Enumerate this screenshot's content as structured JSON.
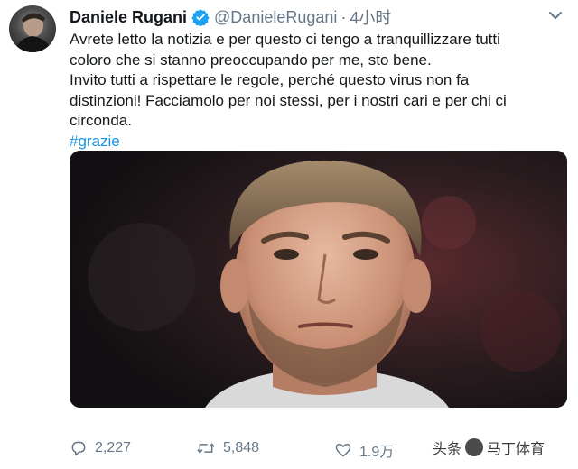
{
  "tweet": {
    "display_name": "Daniele Rugani",
    "handle": "@DanieleRugani",
    "separator": "·",
    "time": "4小时",
    "text_lines": [
      "Avrete letto la notizia e per questo ci tengo a tranquillizzare tutti",
      "coloro che si stanno preoccupando per me, sto bene.",
      "Invito tutti a rispettare le regole, perché questo virus non fa",
      "distinzioni! Facciamolo per noi stessi, per i nostri cari e per chi ci",
      "circonda."
    ],
    "hashtag": "#grazie",
    "media_description": "photo-of-player-portrait"
  },
  "actions": {
    "reply_count": "2,227",
    "retweet_count": "5,848",
    "like_count": "1.9万"
  },
  "watermark": {
    "prefix": "头条",
    "suffix": "马丁体育"
  },
  "icons": {
    "verified": "verified-badge-icon",
    "caret": "chevron-down-icon",
    "reply": "reply-icon",
    "retweet": "retweet-icon",
    "like": "heart-icon",
    "share": "share-icon"
  },
  "colors": {
    "name": "#14171a",
    "secondary": "#657786",
    "hashtag": "#1b95e0",
    "verified": "#1da1f2"
  }
}
